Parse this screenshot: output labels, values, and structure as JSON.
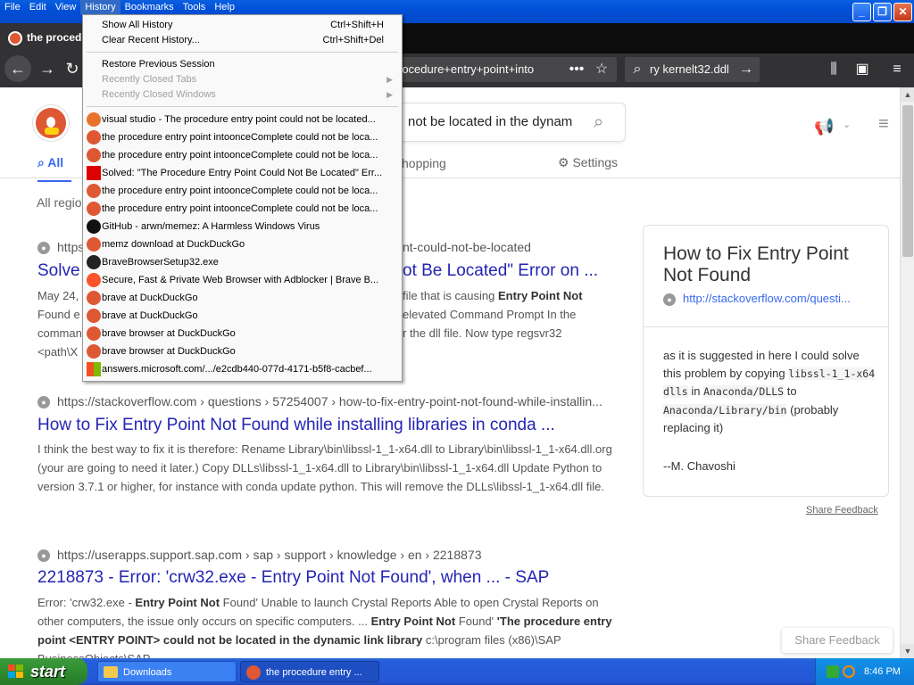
{
  "menubar": {
    "file": "File",
    "edit": "Edit",
    "view": "View",
    "history": "History",
    "bookmarks": "Bookmarks",
    "tools": "Tools",
    "help": "Help"
  },
  "tab": {
    "title": "the procedure"
  },
  "navbar": {
    "url_text": "rocedure+entry+point+into",
    "search_text": "ry kernelt32.ddl"
  },
  "ddg": {
    "search_query": "not be located in the dynam",
    "tabs": {
      "all": "All",
      "shopping": "hopping",
      "settings": "Settings"
    },
    "region": "All regio"
  },
  "results": [
    {
      "url": "https",
      "url_tail": "nt-could-not-be-located",
      "title_a": "Solve",
      "title_b": "ot Be Located\" Error on ...",
      "snip_date": "May 24,",
      "snip1_tail": "file that is causing",
      "snip1_bold": "Entry Point Not",
      "snip2_head": "Found e",
      "snip2_tail": "elevated Command Prompt In the",
      "snip3_head": "comman",
      "snip3_tail": "r the dll file. Now type regsvr32",
      "snip4_head": "<path\\X"
    },
    {
      "url": "https://stackoverflow.com › questions › 57254007 › how-to-fix-entry-point-not-found-while-installin...",
      "title": "How to Fix Entry Point Not Found while installing libraries in conda ...",
      "snippet": "I think the best way to fix it is therefore: Rename Library\\bin\\libssl-1_1-x64.dll to Library\\bin\\libssl-1_1-x64.dll.org (your are going to need it later.) Copy DLLs\\libssl-1_1-x64.dll to Library\\bin\\libssl-1_1-x64.dll Update Python to version 3.7.1 or higher, for instance with conda update python. This will remove the DLLs\\libssl-1_1-x64.dll file."
    },
    {
      "url": "https://userapps.support.sap.com › sap › support › knowledge › en › 2218873",
      "title": "2218873 - Error: 'crw32.exe - Entry Point Not Found', when ... - SAP",
      "s1": "Error: 'crw32.exe -",
      "s1b": "Entry Point Not",
      "s2": "Found' Unable to launch Crystal Reports Able to open Crystal Reports",
      "s3": "on other computers, the issue only occurs on specific computers. ...",
      "s3b": "Entry Point Not",
      "s4": "Found'",
      "s4b": "'The procedure entry point",
      "s5b": "<ENTRY POINT> could not be located in the dynamic link library",
      "s5": "c:\\program files",
      "s6": "(x86)\\SAP BusinessObjects\\SAP"
    }
  ],
  "panel": {
    "title": "How to Fix Entry Point Not Found",
    "url": "http://stackoverflow.com/questi...",
    "body1": "as it is suggested in here I could solve this problem by copying",
    "code1": "libssl-1_1-x64 dlls",
    "in": "in",
    "code2": "Anaconda/DLLS",
    "to": "to",
    "code3": "Anaconda/Library/bin",
    "body2": "(probably replacing it)",
    "author": "--M. Chavoshi",
    "share": "Share Feedback"
  },
  "share_feedback_float": "Share Feedback",
  "history_menu": {
    "show_all": "Show All History",
    "show_all_sc": "Ctrl+Shift+H",
    "clear": "Clear Recent History...",
    "clear_sc": "Ctrl+Shift+Del",
    "restore": "Restore Previous Session",
    "closed_tabs": "Recently Closed Tabs",
    "closed_windows": "Recently Closed Windows",
    "items": [
      {
        "label": "visual studio - The procedure entry point could not be located..."
      },
      {
        "label": "the procedure entry point intoonceComplete could not be loca..."
      },
      {
        "label": "the procedure entry point intoonceComplete could not be loca..."
      },
      {
        "label": "Solved: \"The Procedure Entry Point Could Not Be Located\" Err..."
      },
      {
        "label": "the procedure entry point intoonceComplete could not be loca..."
      },
      {
        "label": "the procedure entry point intoonceComplete could not be loca..."
      },
      {
        "label": "GitHub - arwn/memez: A Harmless Windows Virus"
      },
      {
        "label": "memz download at DuckDuckGo"
      },
      {
        "label": "BraveBrowserSetup32.exe"
      },
      {
        "label": "Secure, Fast & Private Web Browser with Adblocker | Brave B..."
      },
      {
        "label": "brave at DuckDuckGo"
      },
      {
        "label": "brave at DuckDuckGo"
      },
      {
        "label": "brave browser at DuckDuckGo"
      },
      {
        "label": "brave browser at DuckDuckGo"
      },
      {
        "label": "answers.microsoft.com/.../e2cdb440-077d-4171-b5f8-cacbef..."
      }
    ]
  },
  "taskbar": {
    "start": "start",
    "task1": "Downloads",
    "task2": "the procedure entry ...",
    "clock": "8:46 PM"
  }
}
